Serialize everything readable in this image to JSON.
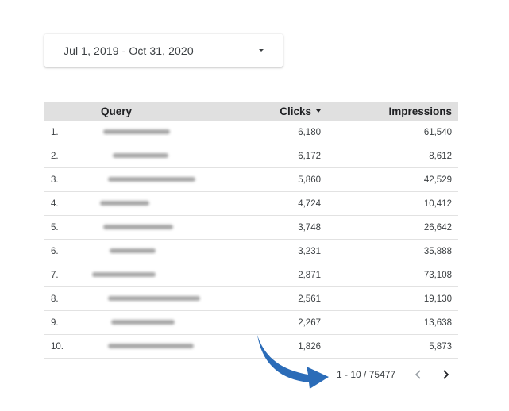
{
  "date_range": {
    "label": "Jul 1, 2019 - Oct 31, 2020",
    "dropdown_icon": "caret-down-icon"
  },
  "table": {
    "columns": {
      "query": "Query",
      "clicks": "Clicks",
      "impressions": "Impressions"
    },
    "sort_icon": "sort-descending-icon",
    "header_bg": "#e0e0e0",
    "rows": [
      {
        "index": "1.",
        "clicks": "6,180",
        "impressions": "61,540"
      },
      {
        "index": "2.",
        "clicks": "6,172",
        "impressions": "8,612"
      },
      {
        "index": "3.",
        "clicks": "5,860",
        "impressions": "42,529"
      },
      {
        "index": "4.",
        "clicks": "4,724",
        "impressions": "10,412"
      },
      {
        "index": "5.",
        "clicks": "3,748",
        "impressions": "26,642"
      },
      {
        "index": "6.",
        "clicks": "3,231",
        "impressions": "35,888"
      },
      {
        "index": "7.",
        "clicks": "2,871",
        "impressions": "73,108"
      },
      {
        "index": "8.",
        "clicks": "2,561",
        "impressions": "19,130"
      },
      {
        "index": "9.",
        "clicks": "2,267",
        "impressions": "13,638"
      },
      {
        "index": "10.",
        "clicks": "1,826",
        "impressions": "5,873"
      }
    ]
  },
  "pagination": {
    "range": "1 - 10 / 75477",
    "prev_icon": "chevron-left-icon",
    "next_icon": "chevron-right-icon"
  },
  "annotation": {
    "arrow_icon": "curved-arrow-icon",
    "arrow_color": "#2b6cb8"
  }
}
